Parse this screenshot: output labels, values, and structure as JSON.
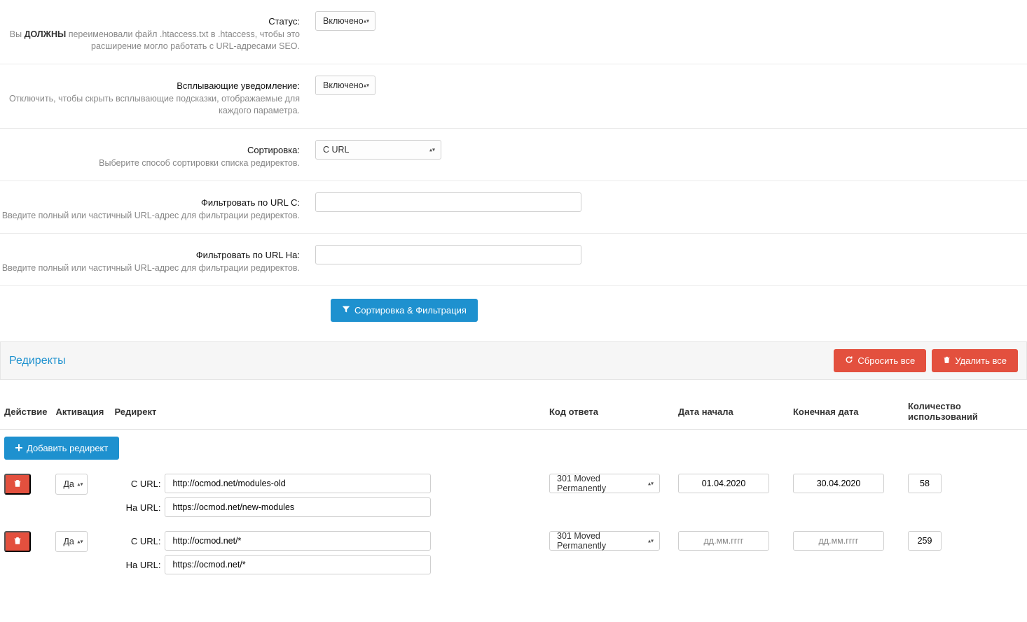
{
  "form": {
    "status": {
      "label": "Статус:",
      "help_pre": "Вы ",
      "help_bold": "ДОЛЖНЫ",
      "help_post": " переименовали файл .htaccess.txt в .htaccess, чтобы это расширение могло работать с URL-адресами SEO.",
      "value": "Включено"
    },
    "popup": {
      "label": "Всплывающие уведомление:",
      "help": "Отключить, чтобы скрыть всплывающие подсказки, отображаемые для каждого параметра.",
      "value": "Включено"
    },
    "sort": {
      "label": "Сортировка:",
      "help": "Выберите способ сортировки списка редиректов.",
      "value": "C URL"
    },
    "filter_from": {
      "label": "Фильтровать по URL С:",
      "help": "Введите полный или частичный URL-адрес для фильтрации редиректов.",
      "value": ""
    },
    "filter_to": {
      "label": "Фильтровать по URL На:",
      "help": "Введите полный или частичный URL-адрес для фильтрации редиректов.",
      "value": ""
    },
    "sort_filter_btn": "Сортировка & Фильтрация"
  },
  "panel": {
    "title": "Редиректы",
    "reset_all": "Сбросить все",
    "delete_all": "Удалить все"
  },
  "table": {
    "cols": {
      "action": "Действие",
      "activation": "Активация",
      "redirect": "Редирект",
      "code": "Код ответа",
      "start": "Дата начала",
      "end": "Конечная дата",
      "count": "Количество использований"
    },
    "add_btn": "Добавить редирект",
    "url_from_label": "C URL:",
    "url_to_label": "На URL:",
    "date_placeholder": "дд.мм.гггг",
    "rows": [
      {
        "activation": "Да",
        "from": "http://ocmod.net/modules-old",
        "to": "https://ocmod.net/new-modules",
        "code": "301 Moved Permanently",
        "start": "01.04.2020",
        "end": "30.04.2020",
        "count": "58"
      },
      {
        "activation": "Да",
        "from": "http://ocmod.net/*",
        "to": "https://ocmod.net/*",
        "code": "301 Moved Permanently",
        "start": "",
        "end": "",
        "count": "259"
      }
    ]
  }
}
